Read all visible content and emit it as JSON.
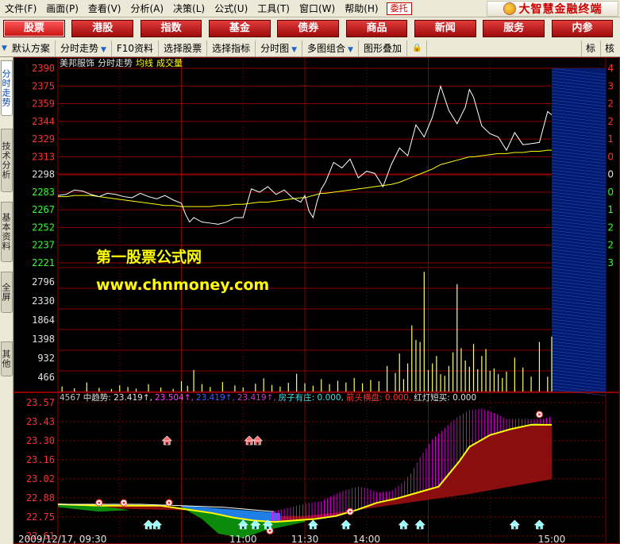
{
  "menubar": {
    "items": [
      "文件(F)",
      "画面(P)",
      "查看(V)",
      "分析(A)",
      "决策(L)",
      "公式(U)",
      "工具(T)",
      "窗口(W)",
      "帮助(H)"
    ],
    "trust_button": "委托",
    "brand": "大智慧金融终端"
  },
  "navbar": {
    "items": [
      "股票",
      "港股",
      "指数",
      "基金",
      "债券",
      "商品",
      "新闻",
      "服务",
      "内参"
    ],
    "active": "股票"
  },
  "toolbar": {
    "items": [
      "默认方案",
      "分时走势",
      "F10资料",
      "选择股票",
      "选择指标",
      "分时图",
      "多图组合",
      "图形叠加"
    ],
    "arrow_items": [
      "分时走势",
      "分时图",
      "多图组合"
    ],
    "lead_arrow": true,
    "right_items": [
      "标",
      "核"
    ]
  },
  "sidetabs": [
    {
      "label": "分时走势",
      "active": true
    },
    {
      "label": "技术分析",
      "active": false
    },
    {
      "label": "基本资料",
      "active": false
    },
    {
      "label": "全屏",
      "active": false
    },
    {
      "label": "其他",
      "active": false
    }
  ],
  "chart_header": {
    "stock": "美邦服饰",
    "view": "分时走势",
    "avg_label": "均线",
    "vol_label": "成交量"
  },
  "watermark": {
    "line1": "第一股票公式网",
    "line2": "www.chnmoney.com"
  },
  "indicator_header": [
    {
      "text": "4567",
      "color": "#c0c0c0"
    },
    {
      "text": "中趋势: 23.419↑,",
      "color": "#e0e0e0"
    },
    {
      "text": "23.504↑,",
      "color": "#ff40ff"
    },
    {
      "text": "23.419↑,",
      "color": "#4060ff"
    },
    {
      "text": "23.419↑,",
      "color": "#c040c0"
    },
    {
      "text": "房子有庄: 0.000,",
      "color": "#40e0e0"
    },
    {
      "text": "箭头横盘: 0.000,",
      "color": "#ff3030"
    },
    {
      "text": "红灯短买: 0.000",
      "color": "#e0e0e0"
    }
  ],
  "colors": {
    "grid": "#8b0000",
    "price_line": "#ffffff",
    "avg_line": "#ffff00",
    "volume": "#ffff66",
    "up_label": "#ff3030",
    "down_label": "#30ff30",
    "axis_white": "#e0e0e0",
    "magenta": "#ff00ff",
    "dark_red_fill": "#9a1010",
    "blue_fill": "#1e7fe6",
    "green_fill": "#0c8a0c"
  },
  "chart_data": [
    {
      "type": "line",
      "name": "intraday",
      "y_ticks_left": [
        "2390",
        "2375",
        "2359",
        "2344",
        "2329",
        "2313",
        "2298",
        "2283",
        "2267",
        "2252",
        "2237",
        "2221"
      ],
      "y_ticks_right": [
        "4",
        "3",
        "2",
        "2",
        "1",
        "0",
        "0",
        "0",
        "1",
        "2",
        "2",
        "3"
      ],
      "ylim": [
        2221,
        2390
      ],
      "x": [
        0,
        4,
        8,
        12,
        16,
        20,
        24,
        28,
        32,
        36,
        40,
        44,
        48,
        52,
        56,
        60,
        62,
        64,
        66,
        70,
        74,
        78,
        82,
        86,
        90,
        94,
        98,
        102,
        106,
        110,
        114,
        118,
        120,
        122,
        124,
        126,
        128,
        130,
        134,
        138,
        142,
        146,
        150,
        154,
        158,
        162,
        166,
        170,
        174,
        178,
        182,
        186,
        190,
        194,
        198,
        200,
        202,
        206,
        210,
        214,
        218,
        222,
        226,
        230,
        234,
        238,
        240
      ],
      "series": [
        {
          "values": [
            2282,
            2283,
            2287,
            2286,
            2283,
            2281,
            2284,
            2283,
            2281,
            2280,
            2284,
            2281,
            2279,
            2282,
            2278,
            2275,
            2265,
            2258,
            2262,
            2258,
            2257,
            2256,
            2258,
            2262,
            2262,
            2288,
            2285,
            2290,
            2283,
            2287,
            2280,
            2276,
            2282,
            2268,
            2262,
            2277,
            2288,
            2294,
            2312,
            2307,
            2315,
            2298,
            2304,
            2302,
            2290,
            2310,
            2325,
            2318,
            2346,
            2335,
            2353,
            2381,
            2359,
            2347,
            2362,
            2378,
            2371,
            2345,
            2338,
            2335,
            2323,
            2339,
            2328,
            2329,
            2330,
            2358,
            2355
          ]
        },
        {
          "values": [
            2281,
            2281,
            2282,
            2282,
            2282,
            2281,
            2280,
            2279,
            2278,
            2277,
            2276,
            2275,
            2274,
            2273,
            2273,
            2272,
            2272,
            2272,
            2272,
            2272,
            2272,
            2273,
            2273,
            2274,
            2274,
            2275,
            2276,
            2276,
            2277,
            2278,
            2279,
            2280,
            2280,
            2281,
            2282,
            2283,
            2284,
            2284,
            2285,
            2286,
            2287,
            2288,
            2289,
            2290,
            2291,
            2292,
            2294,
            2297,
            2300,
            2303,
            2306,
            2310,
            2312,
            2314,
            2316,
            2317,
            2317,
            2318,
            2319,
            2320,
            2320,
            2321,
            2321,
            2322,
            2322,
            2323,
            2323
          ]
        }
      ]
    },
    {
      "type": "bar",
      "name": "volume",
      "y_ticks": [
        "2796",
        "2330",
        "1864",
        "1398",
        "932",
        "466"
      ],
      "ylim": [
        0,
        3000
      ],
      "x": [
        2,
        8,
        14,
        20,
        26,
        30,
        34,
        38,
        44,
        50,
        56,
        60,
        63,
        66,
        70,
        74,
        80,
        86,
        90,
        96,
        100,
        104,
        108,
        112,
        116,
        120,
        124,
        128,
        132,
        136,
        140,
        144,
        148,
        152,
        156,
        160,
        164,
        166,
        168,
        170,
        172,
        174,
        176,
        178,
        180,
        182,
        184,
        186,
        188,
        190,
        192,
        194,
        196,
        198,
        200,
        202,
        204,
        206,
        208,
        210,
        212,
        214,
        216,
        218,
        222,
        226,
        230,
        234,
        238,
        240
      ],
      "values": [
        120,
        80,
        220,
        90,
        60,
        150,
        110,
        70,
        180,
        95,
        65,
        250,
        140,
        520,
        180,
        110,
        230,
        150,
        100,
        190,
        320,
        160,
        120,
        210,
        430,
        200,
        140,
        300,
        180,
        260,
        220,
        330,
        200,
        280,
        250,
        620,
        450,
        920,
        300,
        680,
        1600,
        1250,
        1200,
        2900,
        520,
        680,
        860,
        420,
        380,
        620,
        950,
        2600,
        1050,
        750,
        600,
        1150,
        540,
        860,
        1030,
        500,
        560,
        420,
        330,
        480,
        820,
        580,
        360,
        1200,
        360,
        1330
      ]
    },
    {
      "type": "area",
      "name": "indicator",
      "y_ticks": [
        "23.57",
        "23.43",
        "23.30",
        "23.16",
        "23.02",
        "22.88",
        "22.75",
        "22.61"
      ],
      "ylim": [
        22.61,
        23.57
      ],
      "x_ticks": [
        "2009/12/17, 09:30",
        "11:00",
        "11:30",
        "14:00",
        "15:00"
      ]
    }
  ]
}
